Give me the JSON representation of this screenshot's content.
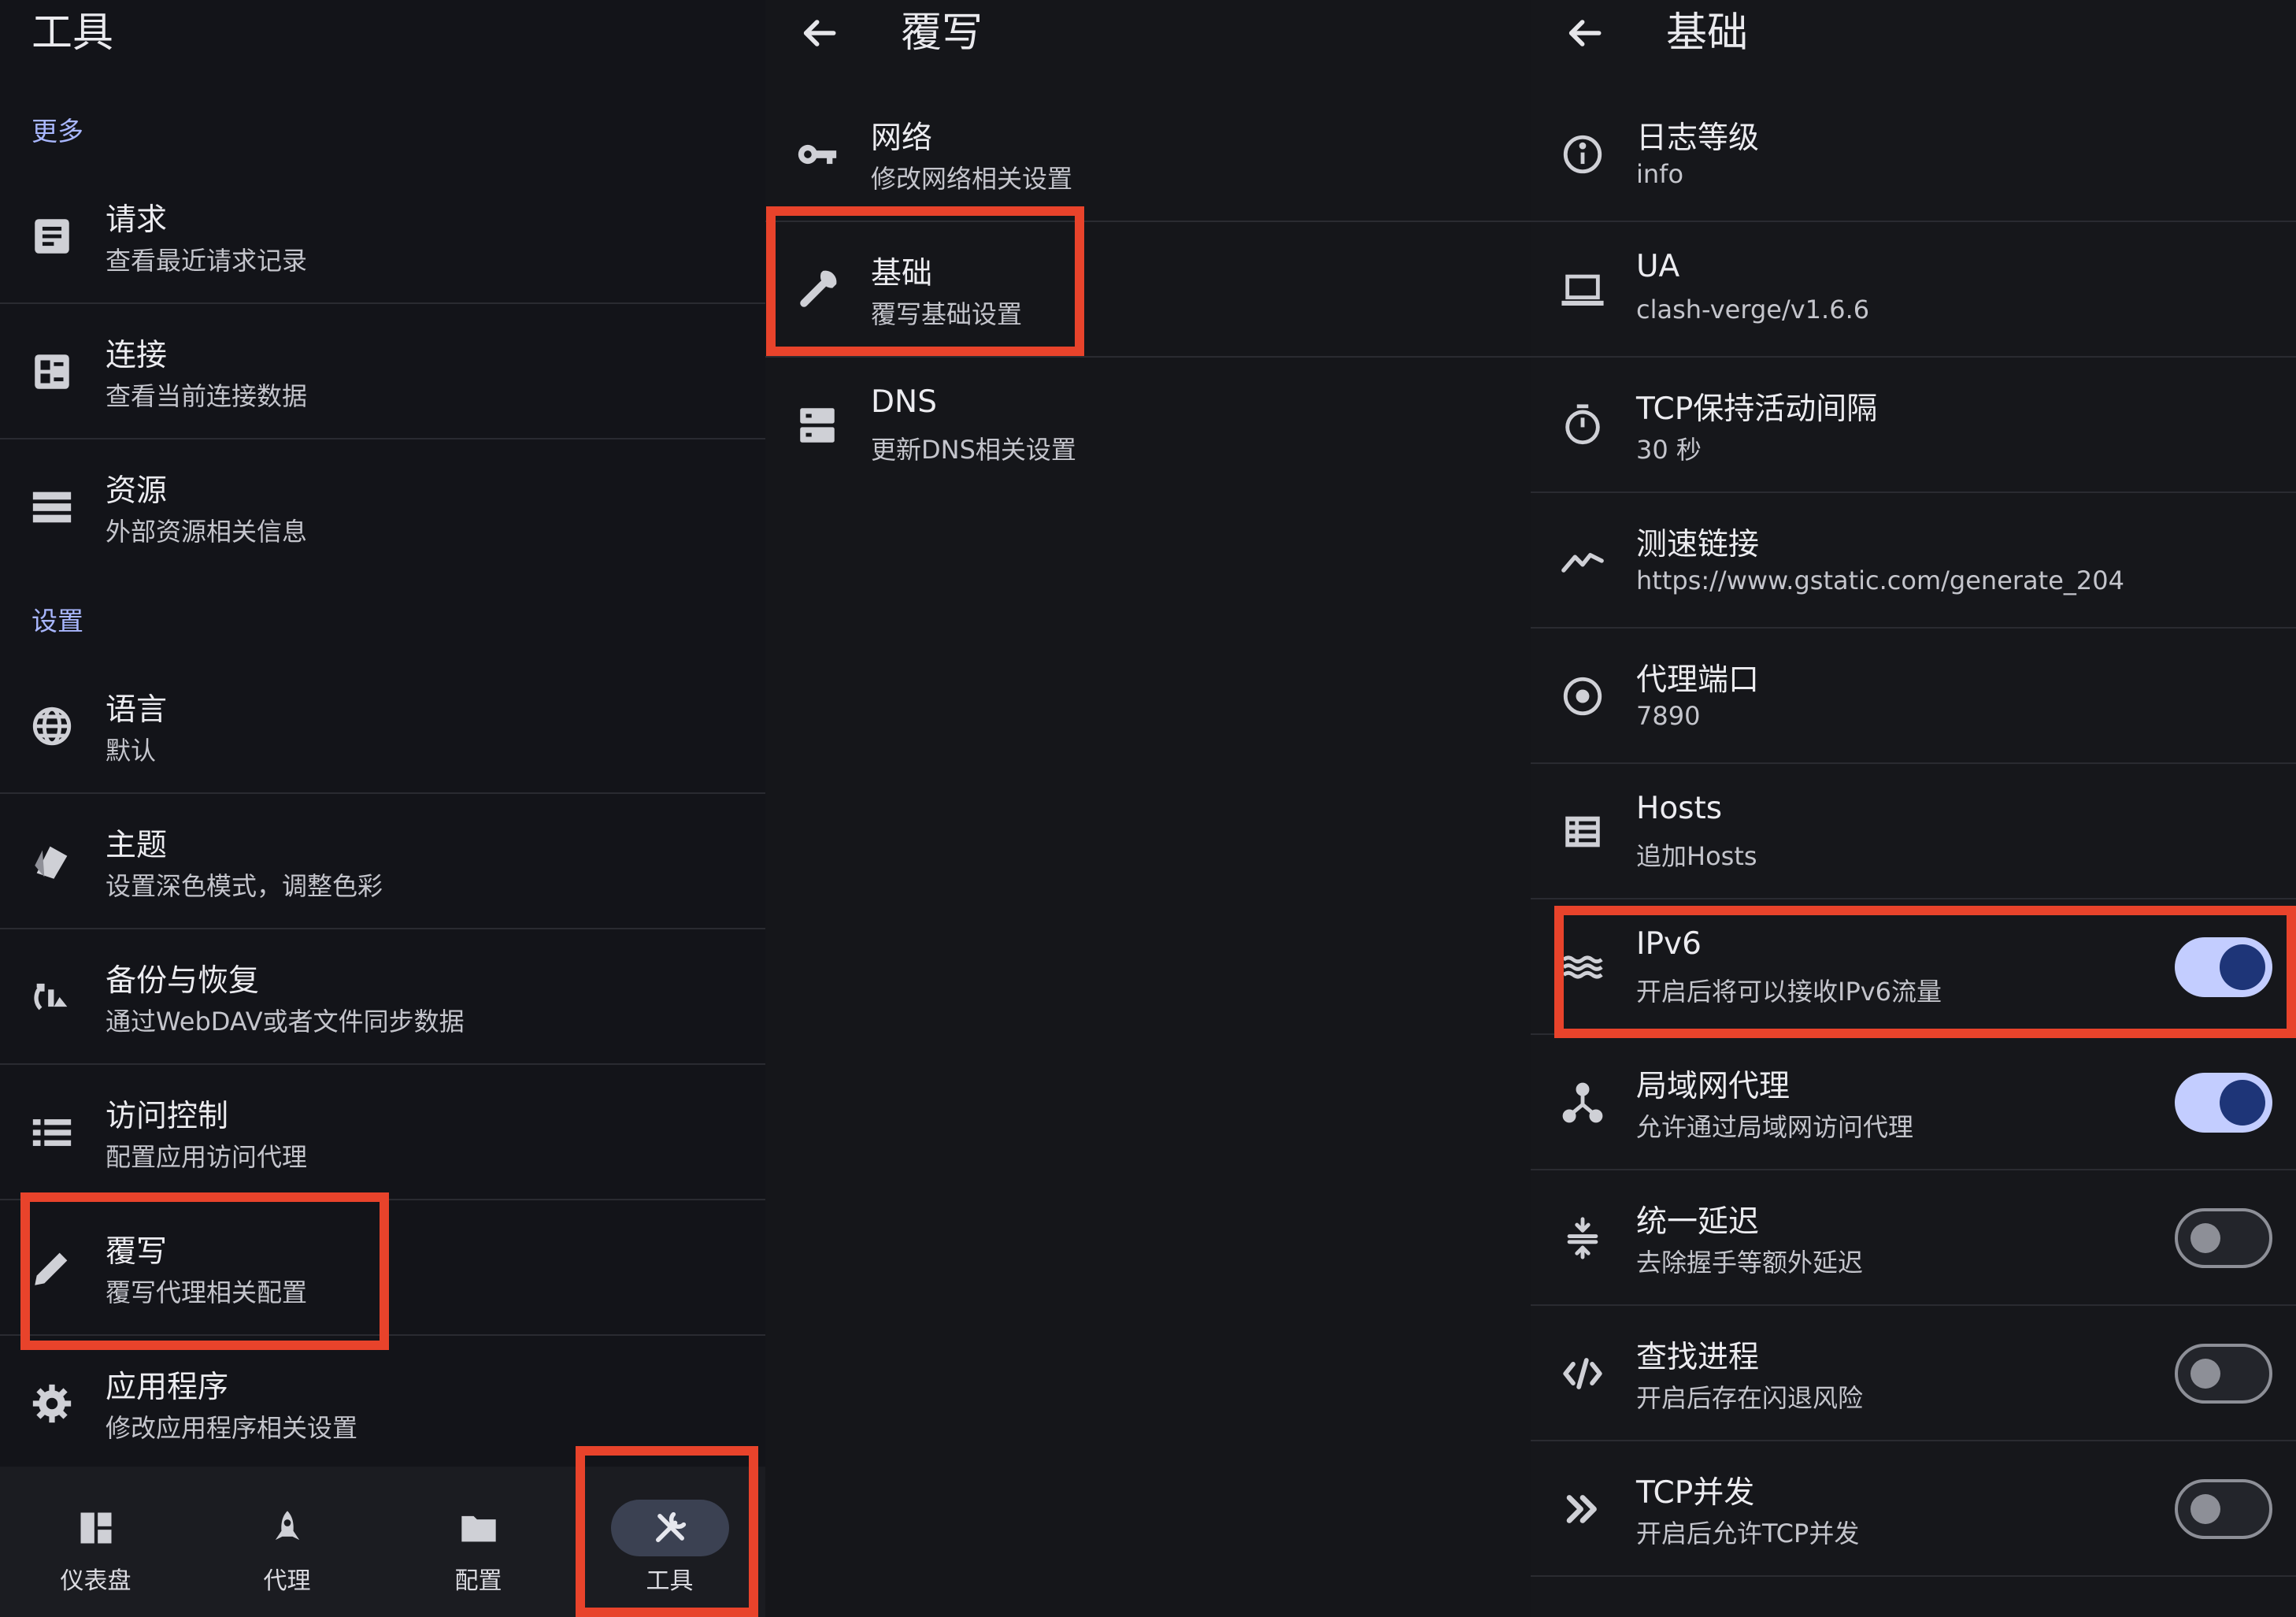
{
  "tools": {
    "title": "工具",
    "section_more": "更多",
    "section_settings": "设置",
    "items": [
      {
        "title": "请求",
        "subtitle": "查看最近请求记录"
      },
      {
        "title": "连接",
        "subtitle": "查看当前连接数据"
      },
      {
        "title": "资源",
        "subtitle": "外部资源相关信息"
      },
      {
        "title": "语言",
        "subtitle": "默认"
      },
      {
        "title": "主题",
        "subtitle": "设置深色模式，调整色彩"
      },
      {
        "title": "备份与恢复",
        "subtitle": "通过WebDAV或者文件同步数据"
      },
      {
        "title": "访问控制",
        "subtitle": "配置应用访问代理"
      },
      {
        "title": "覆写",
        "subtitle": "覆写代理相关配置"
      },
      {
        "title": "应用程序",
        "subtitle": "修改应用程序相关设置"
      }
    ],
    "nav": [
      {
        "label": "仪表盘"
      },
      {
        "label": "代理"
      },
      {
        "label": "配置"
      },
      {
        "label": "工具"
      }
    ]
  },
  "override": {
    "title": "覆写",
    "items": [
      {
        "title": "网络",
        "subtitle": "修改网络相关设置"
      },
      {
        "title": "基础",
        "subtitle": "覆写基础设置"
      },
      {
        "title": "DNS",
        "subtitle": "更新DNS相关设置"
      }
    ]
  },
  "basic": {
    "title": "基础",
    "items": [
      {
        "title": "日志等级",
        "subtitle": "info"
      },
      {
        "title": "UA",
        "subtitle": "clash-verge/v1.6.6"
      },
      {
        "title": "TCP保持活动间隔",
        "subtitle": "30 秒"
      },
      {
        "title": "测速链接",
        "subtitle": "https://www.gstatic.com/generate_204"
      },
      {
        "title": "代理端口",
        "subtitle": "7890"
      },
      {
        "title": "Hosts",
        "subtitle": "追加Hosts"
      },
      {
        "title": "IPv6",
        "subtitle": "开启后将可以接收IPv6流量",
        "enabled": true
      },
      {
        "title": "局域网代理",
        "subtitle": "允许通过局域网访问代理",
        "enabled": true
      },
      {
        "title": "统一延迟",
        "subtitle": "去除握手等额外延迟",
        "enabled": false
      },
      {
        "title": "查找进程",
        "subtitle": "开启后存在闪退风险",
        "enabled": false
      },
      {
        "title": "TCP并发",
        "subtitle": "开启后允许TCP并发",
        "enabled": false
      }
    ]
  },
  "colors": {
    "background": "#131419",
    "accent_section": "#a9b7ff",
    "toggle_on": "#c3cdff",
    "toggle_knob_on": "#1e3578",
    "highlight": "#e8432b"
  }
}
